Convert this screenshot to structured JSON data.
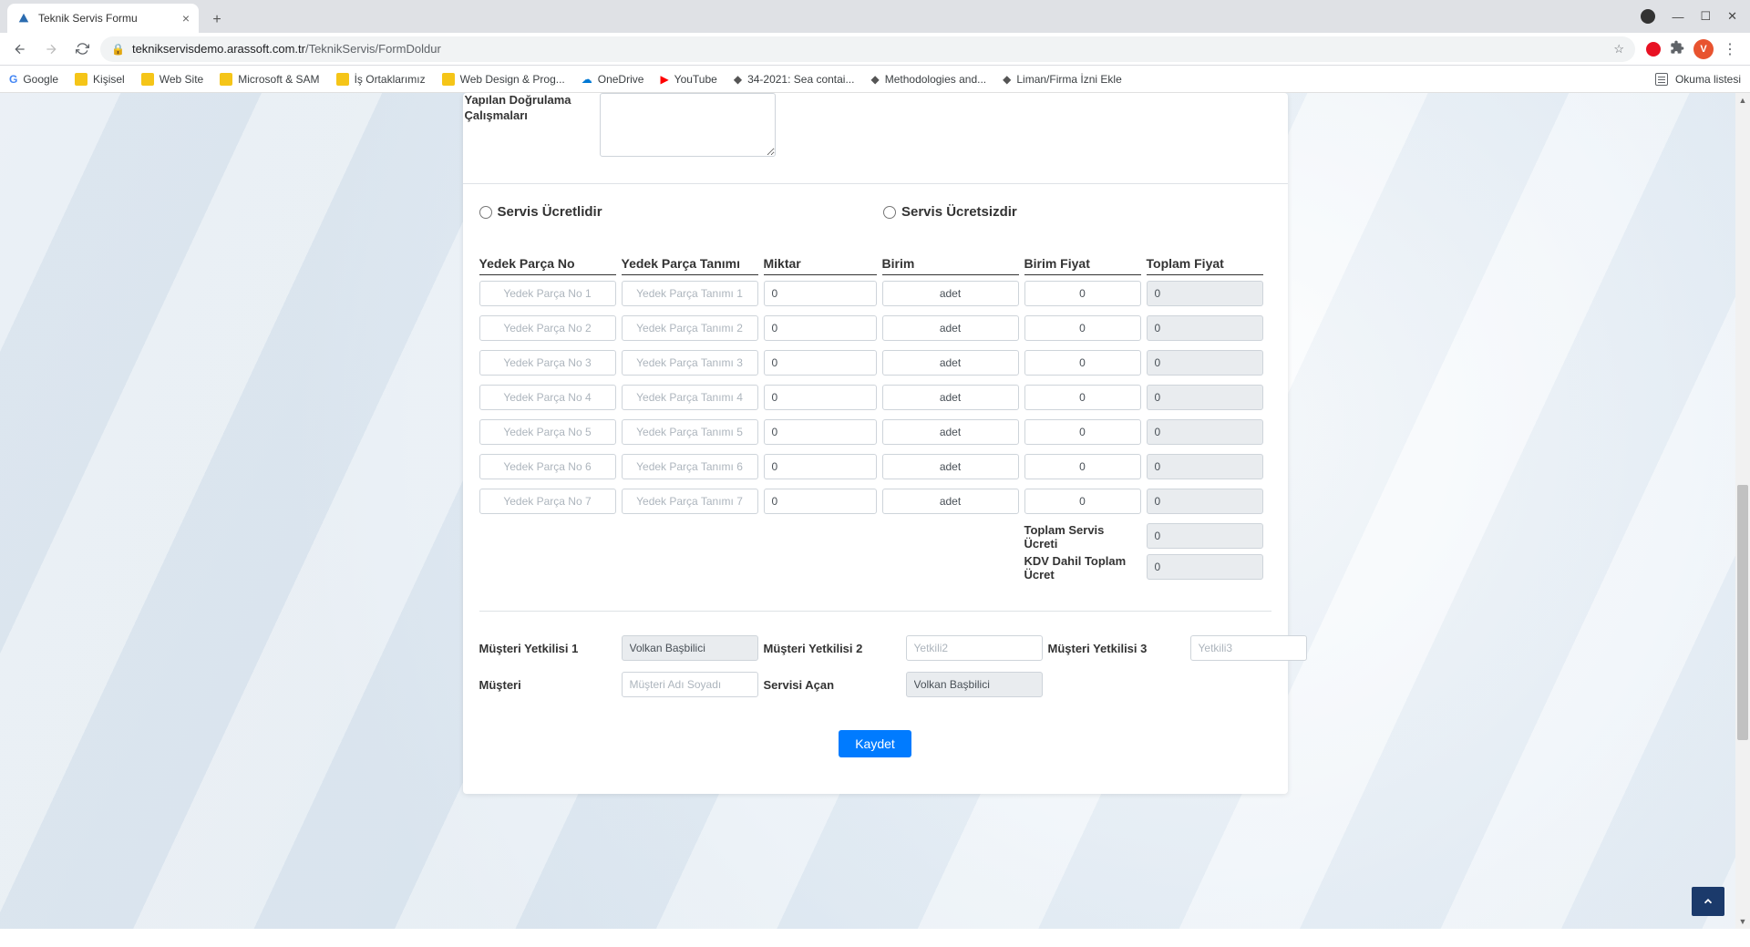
{
  "browser": {
    "tab_title": "Teknik Servis Formu",
    "url_host": "teknikservisdemo.arassoft.com.tr",
    "url_path": "/TeknikServis/FormDoldur",
    "avatar_initial": "V",
    "reading_list": "Okuma listesi",
    "bookmarks": [
      {
        "label": "Google",
        "icon": "g"
      },
      {
        "label": "Kişisel",
        "icon": "folder"
      },
      {
        "label": "Web Site",
        "icon": "folder"
      },
      {
        "label": "Microsoft & SAM",
        "icon": "folder"
      },
      {
        "label": "İş Ortaklarımız",
        "icon": "folder"
      },
      {
        "label": "Web Design & Prog...",
        "icon": "folder"
      },
      {
        "label": "OneDrive",
        "icon": "od"
      },
      {
        "label": "YouTube",
        "icon": "yt"
      },
      {
        "label": "34-2021: Sea contai...",
        "icon": "misc"
      },
      {
        "label": "Methodologies and...",
        "icon": "misc"
      },
      {
        "label": "Liman/Firma İzni Ekle",
        "icon": "misc"
      }
    ]
  },
  "form": {
    "verification_label_line1": "Yapılan Doğrulama",
    "verification_label_line2": "Çalışmaları",
    "verification_value": "",
    "radio_paid": "Servis Ücretlidir",
    "radio_free": "Servis Ücretsizdir",
    "parts_headers": {
      "no": "Yedek Parça No",
      "desc": "Yedek Parça Tanımı",
      "qty": "Miktar",
      "unit": "Birim",
      "price": "Birim Fiyat",
      "total": "Toplam Fiyat"
    },
    "parts": [
      {
        "no_ph": "Yedek Parça No 1",
        "desc_ph": "Yedek Parça Tanımı 1",
        "qty": "0",
        "unit": "adet",
        "price": "0",
        "total": "0"
      },
      {
        "no_ph": "Yedek Parça No 2",
        "desc_ph": "Yedek Parça Tanımı 2",
        "qty": "0",
        "unit": "adet",
        "price": "0",
        "total": "0"
      },
      {
        "no_ph": "Yedek Parça No 3",
        "desc_ph": "Yedek Parça Tanımı 3",
        "qty": "0",
        "unit": "adet",
        "price": "0",
        "total": "0"
      },
      {
        "no_ph": "Yedek Parça No 4",
        "desc_ph": "Yedek Parça Tanımı 4",
        "qty": "0",
        "unit": "adet",
        "price": "0",
        "total": "0"
      },
      {
        "no_ph": "Yedek Parça No 5",
        "desc_ph": "Yedek Parça Tanımı 5",
        "qty": "0",
        "unit": "adet",
        "price": "0",
        "total": "0"
      },
      {
        "no_ph": "Yedek Parça No 6",
        "desc_ph": "Yedek Parça Tanımı 6",
        "qty": "0",
        "unit": "adet",
        "price": "0",
        "total": "0"
      },
      {
        "no_ph": "Yedek Parça No 7",
        "desc_ph": "Yedek Parça Tanımı 7",
        "qty": "0",
        "unit": "adet",
        "price": "0",
        "total": "0"
      }
    ],
    "totals": {
      "service_label": "Toplam Servis Ücreti",
      "service_value": "0",
      "vat_label": "KDV Dahil Toplam Ücret",
      "vat_value": "0"
    },
    "auth": {
      "y1_label": "Müşteri Yetkilisi 1",
      "y1_value": "Volkan Başbilici",
      "y2_label": "Müşteri Yetkilisi 2",
      "y2_placeholder": "Yetkili2",
      "y3_label": "Müşteri Yetkilisi 3",
      "y3_placeholder": "Yetkili3",
      "cust_label": "Müşteri",
      "cust_placeholder": "Müşteri Adı Soyadı",
      "opener_label": "Servisi Açan",
      "opener_value": "Volkan Başbilici"
    },
    "save_label": "Kaydet"
  }
}
